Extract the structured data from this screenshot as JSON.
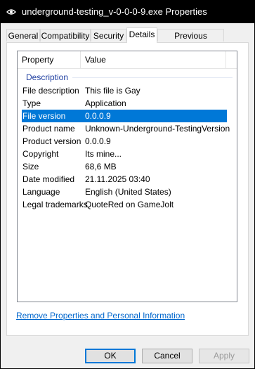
{
  "window": {
    "title": "underground-testing_v-0-0-0-9.exe Properties",
    "icon": "eye-icon"
  },
  "tabs": [
    {
      "label": "General"
    },
    {
      "label": "Compatibility"
    },
    {
      "label": "Security"
    },
    {
      "label": "Details",
      "active": true
    },
    {
      "label": "Previous Versions"
    }
  ],
  "details": {
    "columns": {
      "property": "Property",
      "value": "Value"
    },
    "group": "Description",
    "rows": [
      {
        "key": "File description",
        "value": "This file is Gay"
      },
      {
        "key": "Type",
        "value": "Application"
      },
      {
        "key": "File version",
        "value": "0.0.0.9",
        "selected": true
      },
      {
        "key": "Product name",
        "value": "Unknown-Underground-TestingVersion"
      },
      {
        "key": "Product version",
        "value": "0.0.0.9"
      },
      {
        "key": "Copyright",
        "value": "Its mine..."
      },
      {
        "key": "Size",
        "value": "68,6 MB"
      },
      {
        "key": "Date modified",
        "value": "21.11.2025 03:40"
      },
      {
        "key": "Language",
        "value": "English (United States)"
      },
      {
        "key": "Legal trademarks",
        "value": "QuoteRed on GameJolt"
      }
    ]
  },
  "link": {
    "label": "Remove Properties and Personal Information"
  },
  "buttons": {
    "ok": "OK",
    "cancel": "Cancel",
    "apply": "Apply"
  },
  "colors": {
    "selection": "#0078d7",
    "group_header": "#1e3ea0",
    "link": "#0066cc"
  }
}
